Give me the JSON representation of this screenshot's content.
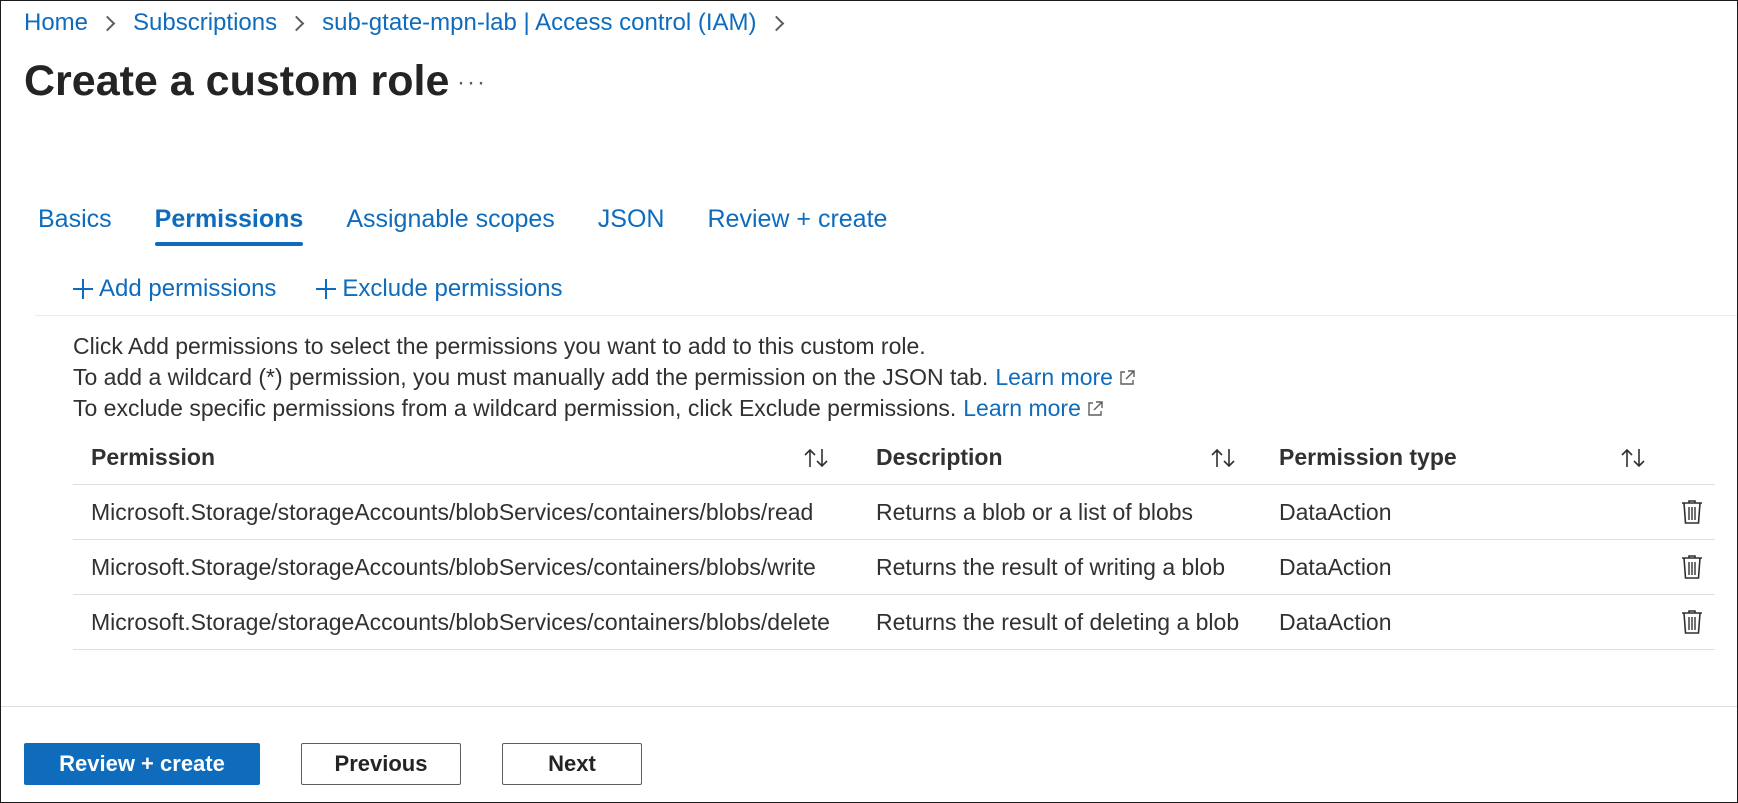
{
  "breadcrumb": {
    "items": [
      "Home",
      "Subscriptions",
      "sub-gtate-mpn-lab | Access control (IAM)"
    ]
  },
  "page": {
    "title": "Create a custom role",
    "more_label": "···"
  },
  "tabs": [
    {
      "label": "Basics",
      "active": false
    },
    {
      "label": "Permissions",
      "active": true
    },
    {
      "label": "Assignable scopes",
      "active": false
    },
    {
      "label": "JSON",
      "active": false
    },
    {
      "label": "Review + create",
      "active": false
    }
  ],
  "commands": {
    "add_permissions": "Add permissions",
    "exclude_permissions": "Exclude permissions"
  },
  "info": {
    "line1": "Click Add permissions to select the permissions you want to add to this custom role.",
    "line2": "To add a wildcard (*) permission, you must manually add the permission on the JSON tab.",
    "line3": "To exclude specific permissions from a wildcard permission, click Exclude permissions.",
    "learn_more": "Learn more"
  },
  "table": {
    "headers": {
      "permission": "Permission",
      "description": "Description",
      "permission_type": "Permission type"
    },
    "rows": [
      {
        "permission": "Microsoft.Storage/storageAccounts/blobServices/containers/blobs/read",
        "description": "Returns a blob or a list of blobs",
        "type": "DataAction"
      },
      {
        "permission": "Microsoft.Storage/storageAccounts/blobServices/containers/blobs/write",
        "description": "Returns the result of writing a blob",
        "type": "DataAction"
      },
      {
        "permission": "Microsoft.Storage/storageAccounts/blobServices/containers/blobs/delete",
        "description": "Returns the result of deleting a blob",
        "type": "DataAction"
      }
    ]
  },
  "footer": {
    "review_create": "Review + create",
    "previous": "Previous",
    "next": "Next"
  },
  "icons": {
    "chevron": "chevron-right-icon",
    "plus": "plus-icon",
    "external_link": "external-link-icon",
    "sort": "sort-icon",
    "delete": "trash-icon"
  },
  "colors": {
    "accent": "#0f6cbd",
    "text": "#323130",
    "divider": "#e1dfdd"
  }
}
